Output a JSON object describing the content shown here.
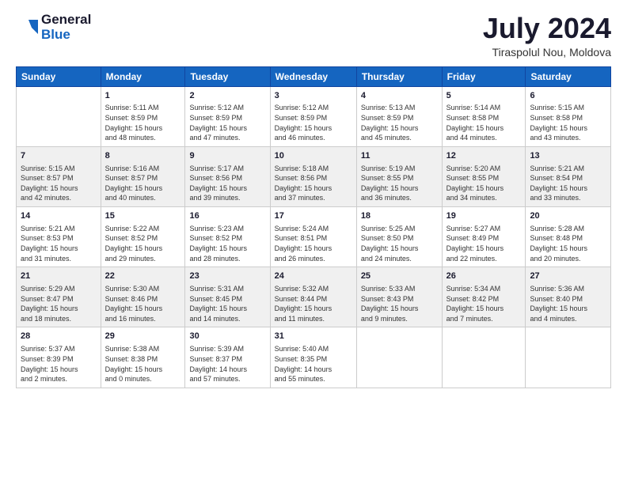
{
  "header": {
    "logo_general": "General",
    "logo_blue": "Blue",
    "month_title": "July 2024",
    "location": "Tiraspolul Nou, Moldova"
  },
  "days_of_week": [
    "Sunday",
    "Monday",
    "Tuesday",
    "Wednesday",
    "Thursday",
    "Friday",
    "Saturday"
  ],
  "weeks": [
    [
      {
        "day": "",
        "info": ""
      },
      {
        "day": "1",
        "info": "Sunrise: 5:11 AM\nSunset: 8:59 PM\nDaylight: 15 hours\nand 48 minutes."
      },
      {
        "day": "2",
        "info": "Sunrise: 5:12 AM\nSunset: 8:59 PM\nDaylight: 15 hours\nand 47 minutes."
      },
      {
        "day": "3",
        "info": "Sunrise: 5:12 AM\nSunset: 8:59 PM\nDaylight: 15 hours\nand 46 minutes."
      },
      {
        "day": "4",
        "info": "Sunrise: 5:13 AM\nSunset: 8:59 PM\nDaylight: 15 hours\nand 45 minutes."
      },
      {
        "day": "5",
        "info": "Sunrise: 5:14 AM\nSunset: 8:58 PM\nDaylight: 15 hours\nand 44 minutes."
      },
      {
        "day": "6",
        "info": "Sunrise: 5:15 AM\nSunset: 8:58 PM\nDaylight: 15 hours\nand 43 minutes."
      }
    ],
    [
      {
        "day": "7",
        "info": "Sunrise: 5:15 AM\nSunset: 8:57 PM\nDaylight: 15 hours\nand 42 minutes."
      },
      {
        "day": "8",
        "info": "Sunrise: 5:16 AM\nSunset: 8:57 PM\nDaylight: 15 hours\nand 40 minutes."
      },
      {
        "day": "9",
        "info": "Sunrise: 5:17 AM\nSunset: 8:56 PM\nDaylight: 15 hours\nand 39 minutes."
      },
      {
        "day": "10",
        "info": "Sunrise: 5:18 AM\nSunset: 8:56 PM\nDaylight: 15 hours\nand 37 minutes."
      },
      {
        "day": "11",
        "info": "Sunrise: 5:19 AM\nSunset: 8:55 PM\nDaylight: 15 hours\nand 36 minutes."
      },
      {
        "day": "12",
        "info": "Sunrise: 5:20 AM\nSunset: 8:55 PM\nDaylight: 15 hours\nand 34 minutes."
      },
      {
        "day": "13",
        "info": "Sunrise: 5:21 AM\nSunset: 8:54 PM\nDaylight: 15 hours\nand 33 minutes."
      }
    ],
    [
      {
        "day": "14",
        "info": "Sunrise: 5:21 AM\nSunset: 8:53 PM\nDaylight: 15 hours\nand 31 minutes."
      },
      {
        "day": "15",
        "info": "Sunrise: 5:22 AM\nSunset: 8:52 PM\nDaylight: 15 hours\nand 29 minutes."
      },
      {
        "day": "16",
        "info": "Sunrise: 5:23 AM\nSunset: 8:52 PM\nDaylight: 15 hours\nand 28 minutes."
      },
      {
        "day": "17",
        "info": "Sunrise: 5:24 AM\nSunset: 8:51 PM\nDaylight: 15 hours\nand 26 minutes."
      },
      {
        "day": "18",
        "info": "Sunrise: 5:25 AM\nSunset: 8:50 PM\nDaylight: 15 hours\nand 24 minutes."
      },
      {
        "day": "19",
        "info": "Sunrise: 5:27 AM\nSunset: 8:49 PM\nDaylight: 15 hours\nand 22 minutes."
      },
      {
        "day": "20",
        "info": "Sunrise: 5:28 AM\nSunset: 8:48 PM\nDaylight: 15 hours\nand 20 minutes."
      }
    ],
    [
      {
        "day": "21",
        "info": "Sunrise: 5:29 AM\nSunset: 8:47 PM\nDaylight: 15 hours\nand 18 minutes."
      },
      {
        "day": "22",
        "info": "Sunrise: 5:30 AM\nSunset: 8:46 PM\nDaylight: 15 hours\nand 16 minutes."
      },
      {
        "day": "23",
        "info": "Sunrise: 5:31 AM\nSunset: 8:45 PM\nDaylight: 15 hours\nand 14 minutes."
      },
      {
        "day": "24",
        "info": "Sunrise: 5:32 AM\nSunset: 8:44 PM\nDaylight: 15 hours\nand 11 minutes."
      },
      {
        "day": "25",
        "info": "Sunrise: 5:33 AM\nSunset: 8:43 PM\nDaylight: 15 hours\nand 9 minutes."
      },
      {
        "day": "26",
        "info": "Sunrise: 5:34 AM\nSunset: 8:42 PM\nDaylight: 15 hours\nand 7 minutes."
      },
      {
        "day": "27",
        "info": "Sunrise: 5:36 AM\nSunset: 8:40 PM\nDaylight: 15 hours\nand 4 minutes."
      }
    ],
    [
      {
        "day": "28",
        "info": "Sunrise: 5:37 AM\nSunset: 8:39 PM\nDaylight: 15 hours\nand 2 minutes."
      },
      {
        "day": "29",
        "info": "Sunrise: 5:38 AM\nSunset: 8:38 PM\nDaylight: 15 hours\nand 0 minutes."
      },
      {
        "day": "30",
        "info": "Sunrise: 5:39 AM\nSunset: 8:37 PM\nDaylight: 14 hours\nand 57 minutes."
      },
      {
        "day": "31",
        "info": "Sunrise: 5:40 AM\nSunset: 8:35 PM\nDaylight: 14 hours\nand 55 minutes."
      },
      {
        "day": "",
        "info": ""
      },
      {
        "day": "",
        "info": ""
      },
      {
        "day": "",
        "info": ""
      }
    ]
  ]
}
